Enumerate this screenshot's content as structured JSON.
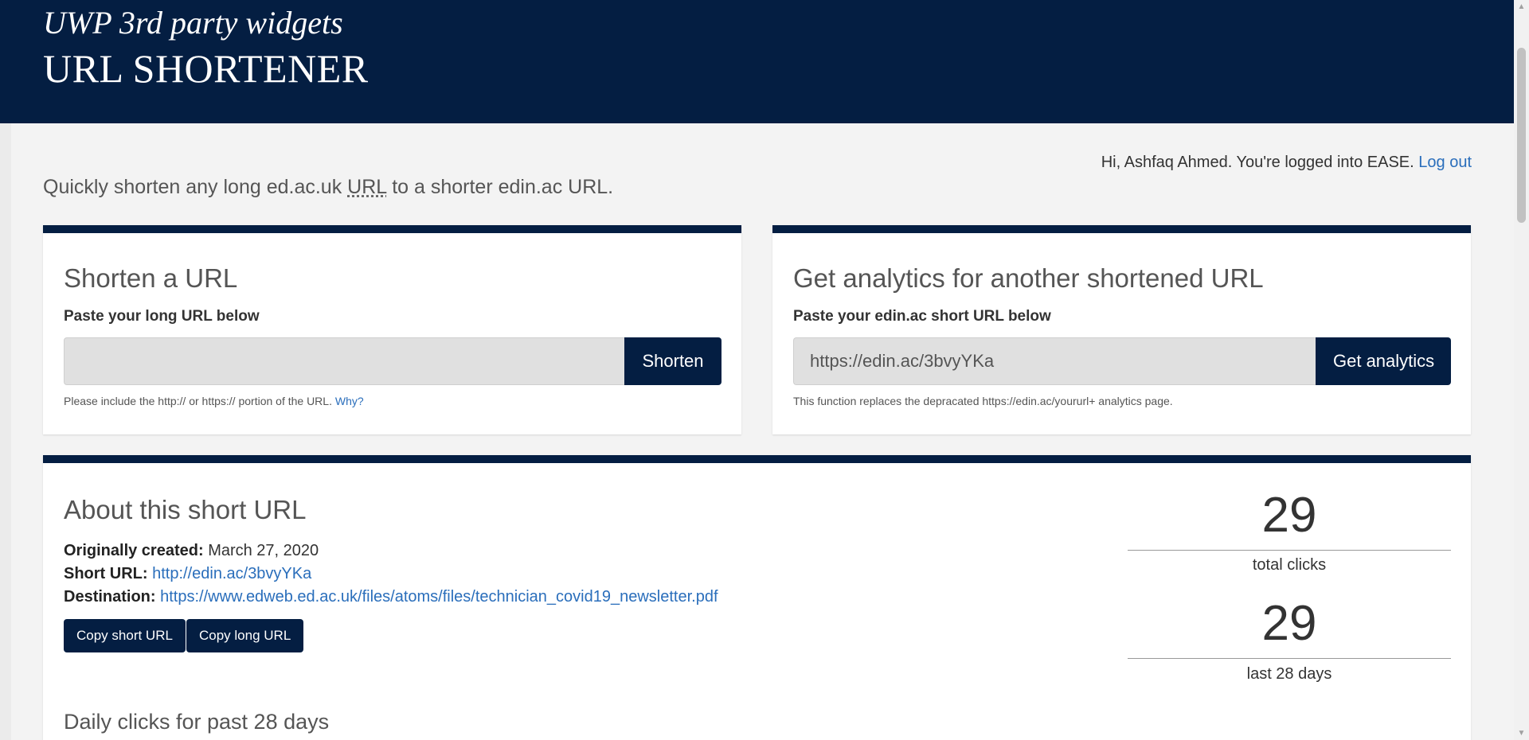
{
  "header": {
    "subtitle": "UWP 3rd party widgets",
    "title": "URL SHORTENER"
  },
  "login": {
    "greeting": "Hi, Ashfaq Ahmed. You're logged into EASE.",
    "logout_label": "Log out"
  },
  "intro": {
    "before": "Quickly shorten any long ed.ac.uk ",
    "abbr": "URL",
    "after": " to a shorter edin.ac URL."
  },
  "shorten": {
    "heading": "Shorten a URL",
    "label": "Paste your long URL below",
    "input_value": "",
    "button_label": "Shorten",
    "help_text": "Please include the http:// or https:// portion of the URL.",
    "help_link": "Why?"
  },
  "analytics": {
    "heading": "Get analytics for another shortened URL",
    "label": "Paste your edin.ac short URL below",
    "input_value": "https://edin.ac/3bvyYKa",
    "button_label": "Get analytics",
    "help_text": "This function replaces the depracated https://edin.ac/yoururl+ analytics page."
  },
  "about": {
    "heading": "About this short URL",
    "created_label": "Originally created:",
    "created_value": "March 27, 2020",
    "short_label": "Short URL:",
    "short_value": "http://edin.ac/3bvyYKa",
    "dest_label": "Destination:",
    "dest_value": "https://www.edweb.ed.ac.uk/files/atoms/files/technician_covid19_newsletter.pdf",
    "copy_short_label": "Copy short URL",
    "copy_long_label": "Copy long URL",
    "daily_heading": "Daily clicks for past 28 days"
  },
  "stats": {
    "total_value": "29",
    "total_label": "total clicks",
    "recent_value": "29",
    "recent_label": "last 28 days"
  },
  "colors": {
    "brand_navy": "#041e42",
    "link_blue": "#2a6ebb"
  }
}
